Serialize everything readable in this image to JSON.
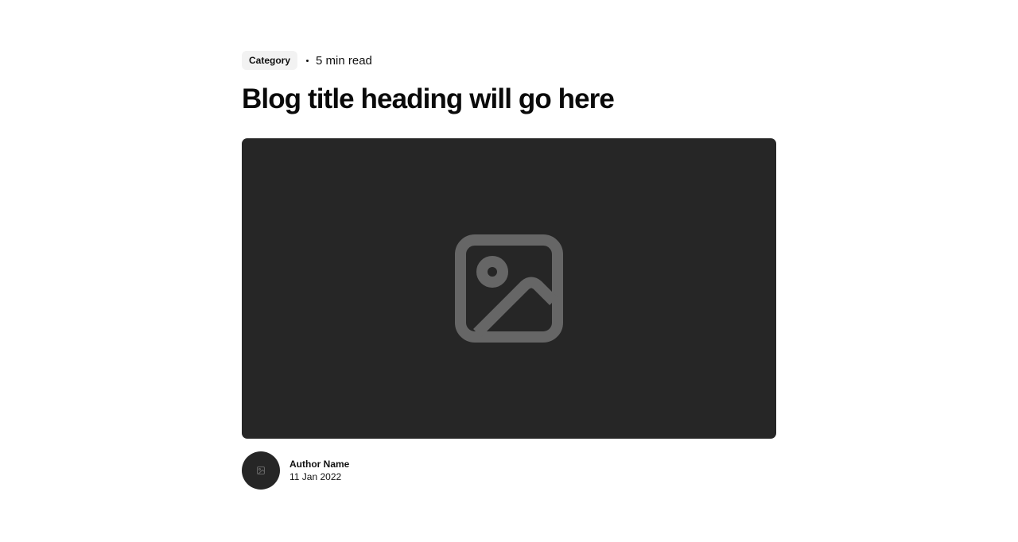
{
  "post": {
    "category": "Category",
    "read_time": "5 min read",
    "title": "Blog title heading will go here",
    "hero_image_icon": "image-placeholder-icon",
    "author": {
      "avatar_icon": "image-placeholder-icon",
      "name": "Author Name",
      "date": "11 Jan 2022"
    }
  },
  "colors": {
    "placeholder_bg": "#262626",
    "placeholder_icon": "#666666",
    "badge_bg": "#f2f2f2",
    "text": "#0a0a0a"
  }
}
